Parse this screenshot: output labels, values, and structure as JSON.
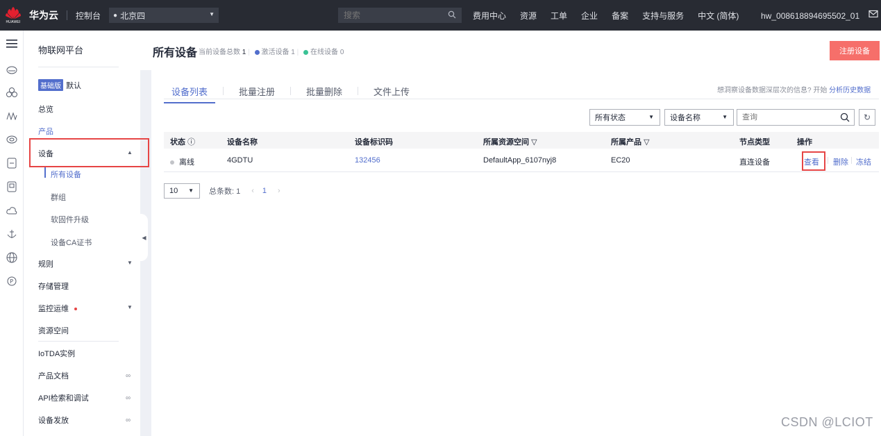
{
  "topbar": {
    "brand": "HUAWEI",
    "cloud_name": "华为云",
    "console": "控制台",
    "region": "北京四",
    "search_placeholder": "搜索",
    "links": [
      "费用中心",
      "资源",
      "工单",
      "企业",
      "备案",
      "支持与服务",
      "中文 (简体)"
    ],
    "user": "hw_008618894695502_01"
  },
  "sidebar": {
    "title": "物联网平台",
    "edition_badge": "基础版",
    "edition_text": "默认",
    "items": {
      "overview": "总览",
      "product": "产品",
      "device": "设备",
      "rules": "规则",
      "storage": "存储管理",
      "monitoring": "监控运维",
      "resource_space": "资源空间",
      "iotda": "IoTDA实例",
      "product_docs": "产品文档",
      "api": "API检索和调试",
      "provisioning": "设备发放"
    },
    "device_sub": [
      "所有设备",
      "群组",
      "软固件升级",
      "设备CA证书"
    ]
  },
  "header": {
    "title": "所有设备",
    "total_label": "当前设备总数",
    "total": "1",
    "activated_label": "激活设备",
    "activated": "1",
    "online_label": "在线设备",
    "online": "0",
    "register_button": "注册设备"
  },
  "tabs": [
    "设备列表",
    "批量注册",
    "批量删除",
    "文件上传"
  ],
  "hint": {
    "text": "想洞察设备数据深层次的信息? 开始",
    "link": "分析历史数据"
  },
  "filters": {
    "status": "所有状态",
    "field": "设备名称",
    "query_placeholder": "查询"
  },
  "table": {
    "columns": [
      "状态",
      "设备名称",
      "设备标识码",
      "所属资源空间",
      "所属产品",
      "节点类型",
      "操作"
    ],
    "rows": [
      {
        "status": "离线",
        "name": "4GDTU",
        "identifier": "132456",
        "resource_space": "DefaultApp_6107nyj8",
        "product": "EC20",
        "node_type": "直连设备",
        "actions": [
          "查看",
          "删除",
          "冻结"
        ]
      }
    ]
  },
  "pager": {
    "page_size": "10",
    "total": "总条数: 1",
    "current_page": "1"
  },
  "watermark": "CSDN @LCIOT",
  "colors": {
    "accent": "#526ecc",
    "register": "#f66f6a",
    "activated_dot": "#526ecc",
    "online_dot": "#3ac295",
    "highlight_box": "#e64545"
  }
}
